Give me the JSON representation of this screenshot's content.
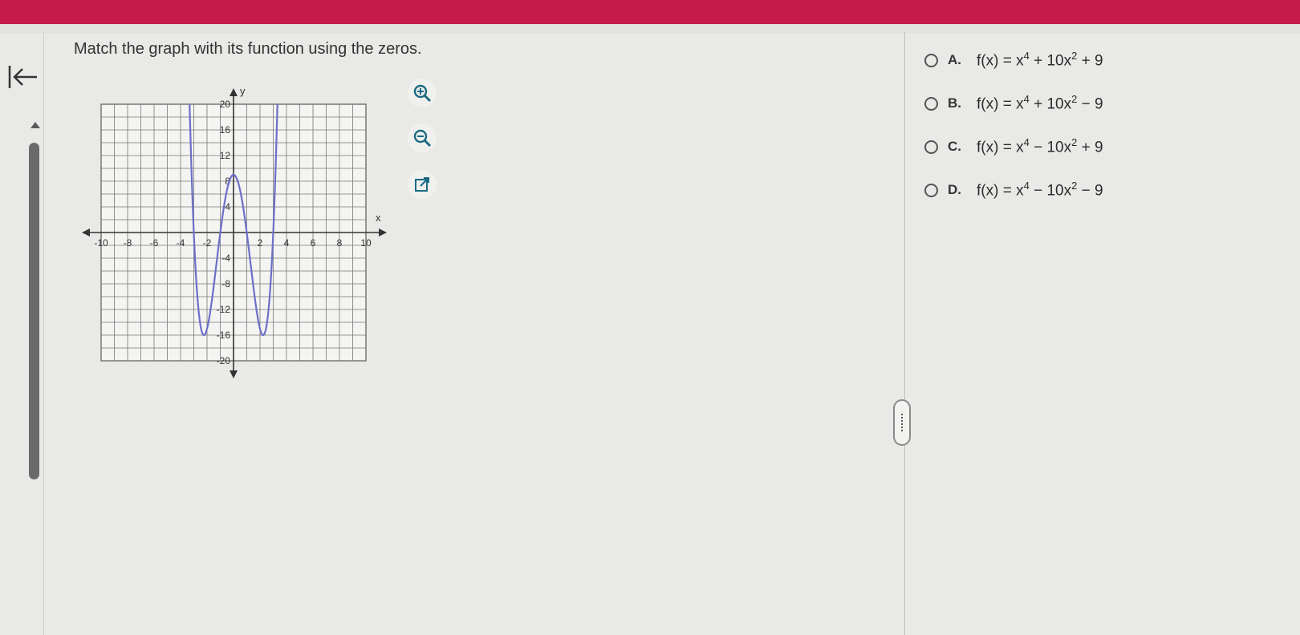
{
  "colors": {
    "top_bar": "#c51b4a",
    "curve": "#6c6fc9",
    "background": "#e9e9e7"
  },
  "question": {
    "text": "Match the graph with its function using the zeros."
  },
  "graph": {
    "x_axis_label": "x",
    "y_axis_label": "y",
    "x_ticks": [
      "-10",
      "-8",
      "-6",
      "-4",
      "-2",
      "2",
      "4",
      "6",
      "8",
      "10"
    ],
    "y_ticks": [
      "20",
      "16",
      "12",
      "8",
      "4",
      "-4",
      "-8",
      "-12",
      "-16",
      "-20"
    ],
    "xlim": [
      -10,
      10
    ],
    "ylim": [
      -20,
      20
    ],
    "grid": true,
    "curve_note_values": {
      "zeros": [
        -3,
        -1,
        1,
        3
      ],
      "local_max_y": 9,
      "min_y": -16
    }
  },
  "tools": [
    {
      "name": "zoom-in",
      "icon": "zoom-in-icon"
    },
    {
      "name": "zoom-out",
      "icon": "zoom-out-icon"
    },
    {
      "name": "open-new-window",
      "icon": "external-link-icon"
    }
  ],
  "options": [
    {
      "letter": "A.",
      "prefix": "f(x) = x",
      "exp1": "4",
      "mid": " + 10x",
      "exp2": "2",
      "suffix": " + 9"
    },
    {
      "letter": "B.",
      "prefix": "f(x) = x",
      "exp1": "4",
      "mid": " + 10x",
      "exp2": "2",
      "suffix": " − 9"
    },
    {
      "letter": "C.",
      "prefix": "f(x) = x",
      "exp1": "4",
      "mid": " − 10x",
      "exp2": "2",
      "suffix": " + 9"
    },
    {
      "letter": "D.",
      "prefix": "f(x) = x",
      "exp1": "4",
      "mid": " − 10x",
      "exp2": "2",
      "suffix": " − 9"
    }
  ]
}
